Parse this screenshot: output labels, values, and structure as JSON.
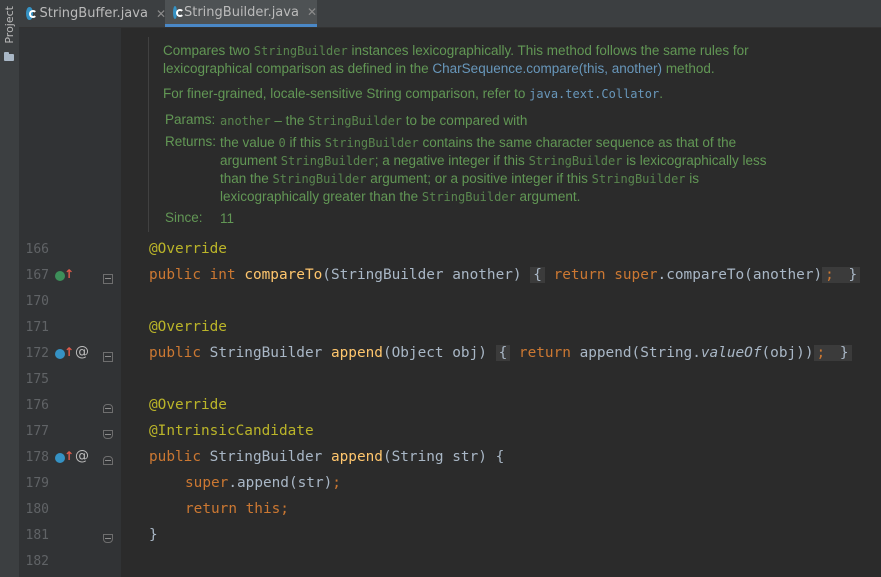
{
  "sidebar": {
    "project_label": "Project"
  },
  "tabs": [
    {
      "label": "StringBuffer.java",
      "active": false
    },
    {
      "label": "StringBuilder.java",
      "active": true
    }
  ],
  "doc": {
    "p1_a": "Compares two ",
    "p1_code": "StringBuilder",
    "p1_b": " instances lexicographically. This method follows the same rules for",
    "p1_c": "lexicographical comparison as defined in the ",
    "p1_link": "CharSequence.compare(this, another)",
    "p1_d": " method.",
    "p2_a": "For finer-grained, locale-sensitive String comparison, refer to ",
    "p2_link": "java.text.Collator",
    "p2_b": ".",
    "params_tag": "Params:",
    "params_code": "another",
    "params_a": " – the ",
    "params_code2": "StringBuilder",
    "params_b": " to be compared with",
    "returns_tag": "Returns:",
    "r1_a": "the value ",
    "r1_code": "0",
    "r1_b": " if this ",
    "r1_code2": "StringBuilder",
    "r1_c": " contains the same character sequence as that of the",
    "r2_a": "argument ",
    "r2_code": "StringBuilder",
    "r2_b": "; a negative integer if this ",
    "r2_code2": "StringBuilder",
    "r2_c": " is lexicographically less",
    "r3_a": "than the ",
    "r3_code": "StringBuilder",
    "r3_b": " argument; or a positive integer if this ",
    "r3_code2": "StringBuilder",
    "r3_c": " is",
    "r4_a": "lexicographically greater than the ",
    "r4_code": "StringBuilder",
    "r4_b": " argument.",
    "since_tag": "Since:",
    "since_val": "11"
  },
  "lines": [
    {
      "num": "166"
    },
    {
      "num": "167"
    },
    {
      "num": "170"
    },
    {
      "num": "171"
    },
    {
      "num": "172"
    },
    {
      "num": "175"
    },
    {
      "num": "176"
    },
    {
      "num": "177"
    },
    {
      "num": "178"
    },
    {
      "num": "179"
    },
    {
      "num": "180"
    },
    {
      "num": "181"
    },
    {
      "num": "182"
    }
  ],
  "code": {
    "l166": "@Override",
    "l167_kw1": "public int ",
    "l167_fn": "compareTo",
    "l167_a": "(StringBuilder another) ",
    "l167_ob": "{",
    "l167_kw2": " return super",
    "l167_b": ".compareTo(another)",
    "l167_semi": ";",
    "l167_cb": " }",
    "l171": "@Override",
    "l172_kw1": "public ",
    "l172_a": "StringBuilder ",
    "l172_fn": "append",
    "l172_b": "(Object obj) ",
    "l172_ob": "{",
    "l172_kw2": " return ",
    "l172_c": "append(String.",
    "l172_it": "valueOf",
    "l172_d": "(obj))",
    "l172_semi": ";",
    "l172_cb": " }",
    "l176": "@Override",
    "l177": "@IntrinsicCandidate",
    "l178_kw1": "public ",
    "l178_a": "StringBuilder ",
    "l178_fn": "append",
    "l178_b": "(String str) {",
    "l179_kw": "super",
    "l179_a": ".append(str)",
    "l179_semi": ";",
    "l180_kw": "return this;",
    "l181": "}"
  },
  "colors": {
    "background": "#2b2b2b",
    "gutter": "#313335",
    "annotation": "#bbb529",
    "keyword": "#cc7832",
    "method": "#ffc66d",
    "doc_text": "#629755",
    "link": "#6897bb",
    "tab_active_underline": "#4a88c7"
  }
}
